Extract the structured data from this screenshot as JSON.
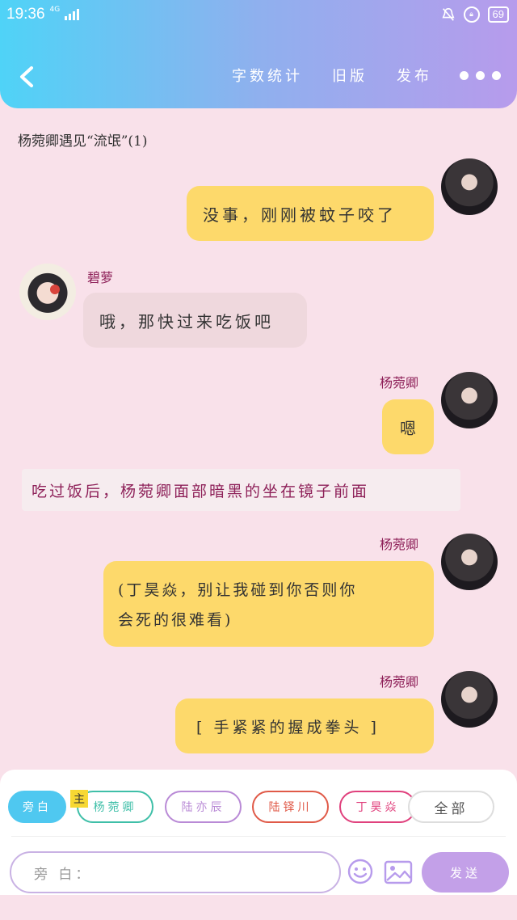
{
  "status_bar": {
    "time": "19:36",
    "network": "4G",
    "battery": "69"
  },
  "header": {
    "menu": [
      "字数统计",
      "旧版",
      "发布"
    ],
    "more_icon": "more-dots-icon",
    "back_icon": "back-chevron-icon"
  },
  "story_title": "杨菀卿遇见“流氓”(1)",
  "messages": [
    {
      "type": "right",
      "speaker": "杨菀卿",
      "text": "没事，刚刚被蚊子咬了"
    },
    {
      "type": "left",
      "speaker": "碧萝",
      "text": "哦，那快过来吃饭吧"
    },
    {
      "type": "right",
      "speaker": "杨菀卿",
      "text": "嗯"
    },
    {
      "type": "narration",
      "text": "吃过饭后，杨菀卿面部暗黑的坐在镜子前面"
    },
    {
      "type": "right",
      "speaker": "杨菀卿",
      "text_line1": "(丁昊焱，别让我碰到你否则你",
      "text_line2": "会死的很难看)"
    },
    {
      "type": "right",
      "speaker": "杨菀卿",
      "text": "[ 手紧紧的握成拳头 ]"
    }
  ],
  "role_chips": {
    "narration": "旁白",
    "main_badge": "主",
    "roles": [
      "杨菀卿",
      "陆亦辰",
      "陆铎川",
      "丁昊焱"
    ],
    "all": "全部"
  },
  "composer": {
    "placeholder": "旁 白：",
    "emoji_icon": "emoji-icon",
    "image_icon": "image-icon",
    "send_label": "发送"
  },
  "colors": {
    "background": "#f9e1ea",
    "header_gradient_start": "#4fd3f7",
    "header_gradient_end": "#b79bec",
    "bubble_yellow": "#fdd96b",
    "speaker_name": "#8e2159",
    "send_button": "#c3a0e8"
  }
}
